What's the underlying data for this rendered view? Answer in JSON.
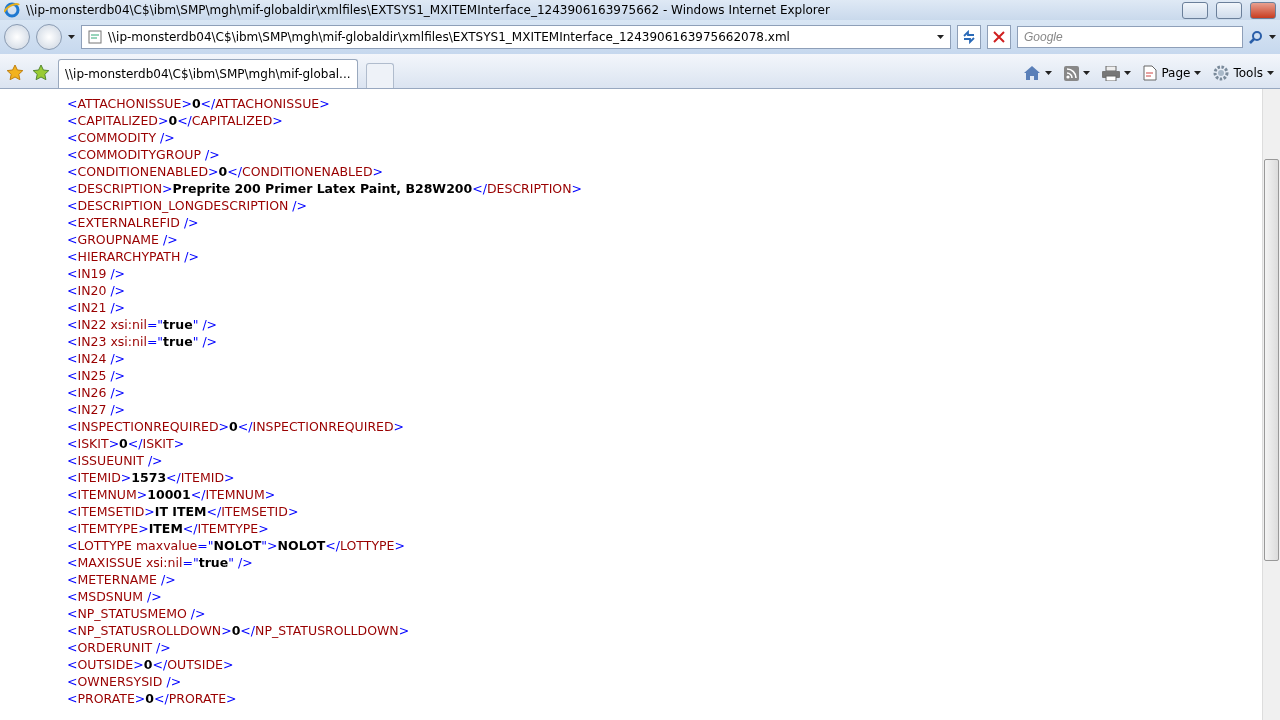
{
  "window": {
    "title": "\\\\ip-monsterdb04\\C$\\ibm\\SMP\\mgh\\mif-globaldir\\xmlfiles\\EXTSYS1_MXITEMInterface_1243906163975662 - Windows Internet Explorer"
  },
  "address_bar": {
    "value": "\\\\ip-monsterdb04\\C$\\ibm\\SMP\\mgh\\mif-globaldir\\xmlfiles\\EXTSYS1_MXITEMInterface_1243906163975662078.xml"
  },
  "search": {
    "placeholder": "Google"
  },
  "tabs": [
    {
      "label": "\\\\ip-monsterdb04\\C$\\ibm\\SMP\\mgh\\mif-global...",
      "selected": true
    }
  ],
  "command_bar": [
    {
      "kind": "home"
    },
    {
      "kind": "feeds"
    },
    {
      "kind": "print"
    },
    {
      "kind": "page",
      "label": "Page"
    },
    {
      "kind": "tools",
      "label": "Tools"
    }
  ],
  "xml_lines": [
    "<ATTACHONISSUE>**0**</ATTACHONISSUE>",
    "<CAPITALIZED>**0**</CAPITALIZED>",
    "<COMMODITY />",
    "<COMMODITYGROUP />",
    "<CONDITIONENABLED>**0**</CONDITIONENABLED>",
    "<DESCRIPTION>**Preprite 200 Primer Latex Paint, B28W200**</DESCRIPTION>",
    "<DESCRIPTION_LONGDESCRIPTION />",
    "<EXTERNALREFID />",
    "<GROUPNAME />",
    "<HIERARCHYPATH />",
    "<IN19 />",
    "<IN20 />",
    "<IN21 />",
    "<IN22 xsi:nil=\"**true**\" />",
    "<IN23 xsi:nil=\"**true**\" />",
    "<IN24 />",
    "<IN25 />",
    "<IN26 />",
    "<IN27 />",
    "<INSPECTIONREQUIRED>**0**</INSPECTIONREQUIRED>",
    "<ISKIT>**0**</ISKIT>",
    "<ISSUEUNIT />",
    "<ITEMID>**1573**</ITEMID>",
    "<ITEMNUM>**10001**</ITEMNUM>",
    "<ITEMSETID>**IT ITEM**</ITEMSETID>",
    "<ITEMTYPE>**ITEM**</ITEMTYPE>",
    "<LOTTYPE maxvalue=\"**NOLOT**\">**NOLOT**</LOTTYPE>",
    "<MAXISSUE xsi:nil=\"**true**\" />",
    "<METERNAME />",
    "<MSDSNUM />",
    "<NP_STATUSMEMO />",
    "<NP_STATUSROLLDOWN>**0**</NP_STATUSROLLDOWN>",
    "<ORDERUNIT />",
    "<OUTSIDE>**0**</OUTSIDE>",
    "<OWNERSYSID />",
    "<PRORATE>**0**</PRORATE>"
  ]
}
